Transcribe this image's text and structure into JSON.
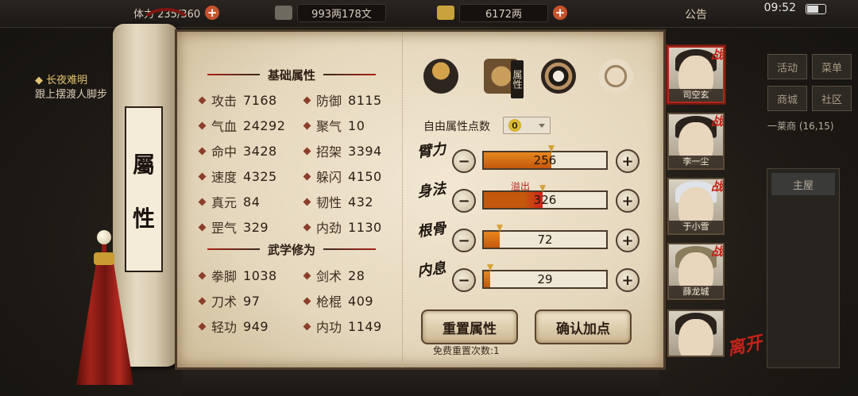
{
  "topbar": {
    "res1": "体力 235/360",
    "money": "993两178文",
    "ingot": "6172两",
    "notice": "公告",
    "clock": "09:52"
  },
  "quest": {
    "title": "◆ 长夜难明",
    "desc": "跟上摆渡人脚步"
  },
  "right_buttons": [
    "活动",
    "菜单",
    "商城",
    "社区"
  ],
  "location": {
    "zone": "一莱商 (16,15)",
    "place": "主屋"
  },
  "scroll_label": [
    "屬",
    "性"
  ],
  "base_section": "基础属性",
  "base_stats": [
    {
      "k": "攻击",
      "v": "7168"
    },
    {
      "k": "防御",
      "v": "8115"
    },
    {
      "k": "气血",
      "v": "24292"
    },
    {
      "k": "聚气",
      "v": "10"
    },
    {
      "k": "命中",
      "v": "3428"
    },
    {
      "k": "招架",
      "v": "3394"
    },
    {
      "k": "速度",
      "v": "4325"
    },
    {
      "k": "躲闪",
      "v": "4150"
    },
    {
      "k": "真元",
      "v": "84"
    },
    {
      "k": "韧性",
      "v": "432"
    },
    {
      "k": "罡气",
      "v": "329"
    },
    {
      "k": "内劲",
      "v": "1130"
    }
  ],
  "martial_section": "武学修为",
  "martial_stats": [
    {
      "k": "拳脚",
      "v": "1038"
    },
    {
      "k": "剑术",
      "v": "28"
    },
    {
      "k": "刀术",
      "v": "97"
    },
    {
      "k": "枪棍",
      "v": "409"
    },
    {
      "k": "轻功",
      "v": "949"
    },
    {
      "k": "内功",
      "v": "1149"
    }
  ],
  "tab_icons": [
    "hat-figure-icon",
    "box-icon",
    "bagua-icon",
    "body-meridian-icon"
  ],
  "attr_tag": "属性",
  "free_points": {
    "label": "自由属性点数",
    "value": "0"
  },
  "overflow_label": "溢出",
  "attributes": [
    {
      "name": "臂力",
      "value": "256",
      "fill": 0.55,
      "over": false
    },
    {
      "name": "身法",
      "value": "326",
      "fill": 0.48,
      "over": true
    },
    {
      "name": "根骨",
      "value": "72",
      "fill": 0.13,
      "over": false
    },
    {
      "name": "内息",
      "value": "29",
      "fill": 0.05,
      "over": false
    }
  ],
  "buttons": {
    "reset": "重置属性",
    "confirm": "确认加点"
  },
  "free_reset": "免费重置次数:1",
  "characters": [
    {
      "name": "司空玄",
      "tag": "战"
    },
    {
      "name": "李一尘",
      "tag": "战"
    },
    {
      "name": "于小雪",
      "tag": "战"
    },
    {
      "name": "薛龙城",
      "tag": "战"
    },
    {
      "name": "",
      "tag": ""
    }
  ],
  "leave_label": "离开"
}
